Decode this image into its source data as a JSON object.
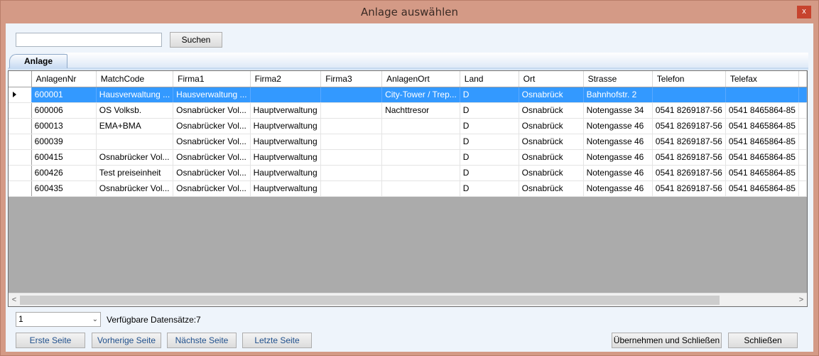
{
  "window": {
    "title": "Anlage auswählen",
    "close_glyph": "x"
  },
  "search": {
    "value": "",
    "placeholder": "",
    "button_label": "Suchen"
  },
  "tab": {
    "label": "Anlage"
  },
  "grid": {
    "columns": [
      "AnlagenNr",
      "MatchCode",
      "Firma1",
      "Firma2",
      "Firma3",
      "AnlagenOrt",
      "Land",
      "Ort",
      "Strasse",
      "Telefon",
      "Telefax"
    ],
    "rows": [
      [
        "600001",
        "Hausverwaltung ...",
        "Hausverwaltung ...",
        "",
        "",
        "City-Tower / Trep...",
        "D",
        "Osnabrück",
        "Bahnhofstr. 2",
        "",
        ""
      ],
      [
        "600006",
        "OS Volksb.",
        "Osnabrücker Vol...",
        "Hauptverwaltung",
        "",
        "Nachttresor",
        "D",
        "Osnabrück",
        "Notengasse 34",
        "0541 8269187-56",
        "0541 8465864-85"
      ],
      [
        "600013",
        "EMA+BMA",
        "Osnabrücker Vol...",
        "Hauptverwaltung",
        "",
        "",
        "D",
        "Osnabrück",
        "Notengasse 46",
        "0541 8269187-56",
        "0541 8465864-85"
      ],
      [
        "600039",
        "",
        "Osnabrücker Vol...",
        "Hauptverwaltung",
        "",
        "",
        "D",
        "Osnabrück",
        "Notengasse 46",
        "0541 8269187-56",
        "0541 8465864-85"
      ],
      [
        "600415",
        "Osnabrücker Vol...",
        "Osnabrücker Vol...",
        "Hauptverwaltung",
        "",
        "",
        "D",
        "Osnabrück",
        "Notengasse 46",
        "0541 8269187-56",
        "0541 8465864-85"
      ],
      [
        "600426",
        "Test preiseinheit",
        "Osnabrücker Vol...",
        "Hauptverwaltung",
        "",
        "",
        "D",
        "Osnabrück",
        "Notengasse 46",
        "0541 8269187-56",
        "0541 8465864-85"
      ],
      [
        "600435",
        "Osnabrücker Vol...",
        "Osnabrücker Vol...",
        "Hauptverwaltung",
        "",
        "",
        "D",
        "Osnabrück",
        "Notengasse 46",
        "0541 8269187-56",
        "0541 8465864-85"
      ]
    ],
    "selected_row": 0
  },
  "scrollbar": {
    "left_glyph": "<",
    "right_glyph": ">"
  },
  "pager": {
    "page_value": "1",
    "count_label": "Verfügbare Datensätze:",
    "count_value": "7",
    "first_label": "Erste Seite",
    "prev_label": "Vorherige Seite",
    "next_label": "Nächste Seite",
    "last_label": "Letzte Seite"
  },
  "actions": {
    "apply_close_label": "Übernehmen und Schließen",
    "close_label": "Schließen"
  },
  "colors": {
    "selection": "#3399ff",
    "frame": "#d49a86",
    "grid_empty": "#ababab"
  }
}
